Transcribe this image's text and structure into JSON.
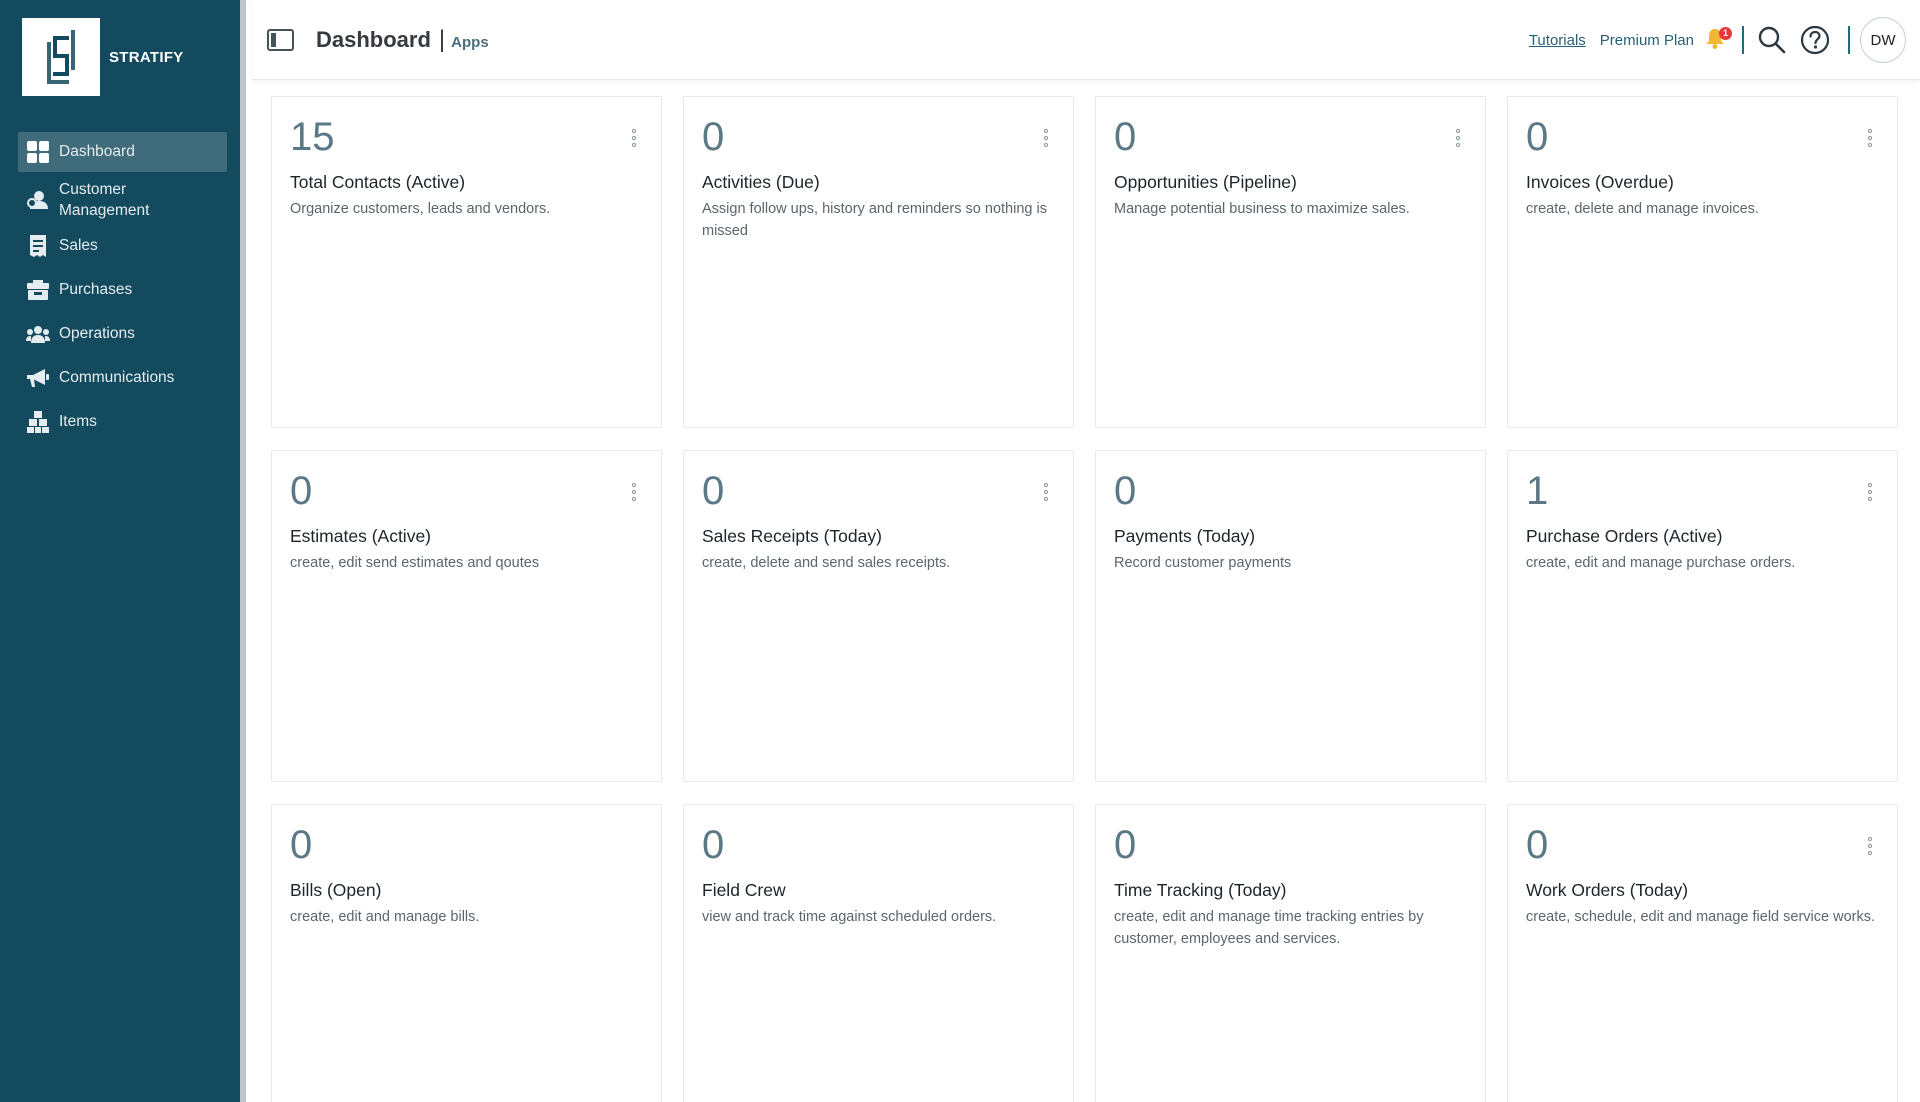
{
  "brand": {
    "name": "STRATIFY"
  },
  "sidebar": {
    "items": [
      {
        "label": "Dashboard",
        "icon": "dashboard-icon"
      },
      {
        "label": "Customer Management",
        "icon": "customer-icon"
      },
      {
        "label": "Sales",
        "icon": "sales-icon"
      },
      {
        "label": "Purchases",
        "icon": "purchases-icon"
      },
      {
        "label": "Operations",
        "icon": "operations-icon"
      },
      {
        "label": "Communications",
        "icon": "megaphone-icon"
      },
      {
        "label": "Items",
        "icon": "items-icon"
      }
    ]
  },
  "header": {
    "title": "Dashboard",
    "separator": "|",
    "subtitle": "Apps",
    "tutorials": "Tutorials",
    "plan": "Premium Plan",
    "notification_count": "1",
    "avatar_initials": "DW"
  },
  "cards": [
    {
      "count": "15",
      "title": "Total Contacts (Active)",
      "description": "Organize customers, leads and vendors."
    },
    {
      "count": "0",
      "title": "Activities (Due)",
      "description": "Assign follow ups, history and reminders so nothing is missed"
    },
    {
      "count": "0",
      "title": "Opportunities (Pipeline)",
      "description": "Manage potential business to maximize sales."
    },
    {
      "count": "0",
      "title": "Invoices (Overdue)",
      "description": "create, delete and manage invoices."
    },
    {
      "count": "0",
      "title": "Estimates (Active)",
      "description": "create, edit send estimates and qoutes"
    },
    {
      "count": "0",
      "title": "Sales Receipts (Today)",
      "description": "create, delete and send sales receipts."
    },
    {
      "count": "0",
      "title": "Payments (Today)",
      "description": "Record customer payments"
    },
    {
      "count": "1",
      "title": "Purchase Orders (Active)",
      "description": "create, edit and manage purchase orders."
    },
    {
      "count": "0",
      "title": "Bills (Open)",
      "description": "create, edit and manage bills."
    },
    {
      "count": "0",
      "title": "Field Crew",
      "description": "view and track time against scheduled orders."
    },
    {
      "count": "0",
      "title": "Time Tracking (Today)",
      "description": "create, edit and manage time tracking entries by customer, employees and services."
    },
    {
      "count": "0",
      "title": "Work Orders (Today)",
      "description": "create, schedule, edit and manage field service works."
    }
  ],
  "colors": {
    "sidebar": "#134a5e",
    "accent": "#2c6075",
    "count": "#5a7886",
    "badge": "#e53935"
  }
}
